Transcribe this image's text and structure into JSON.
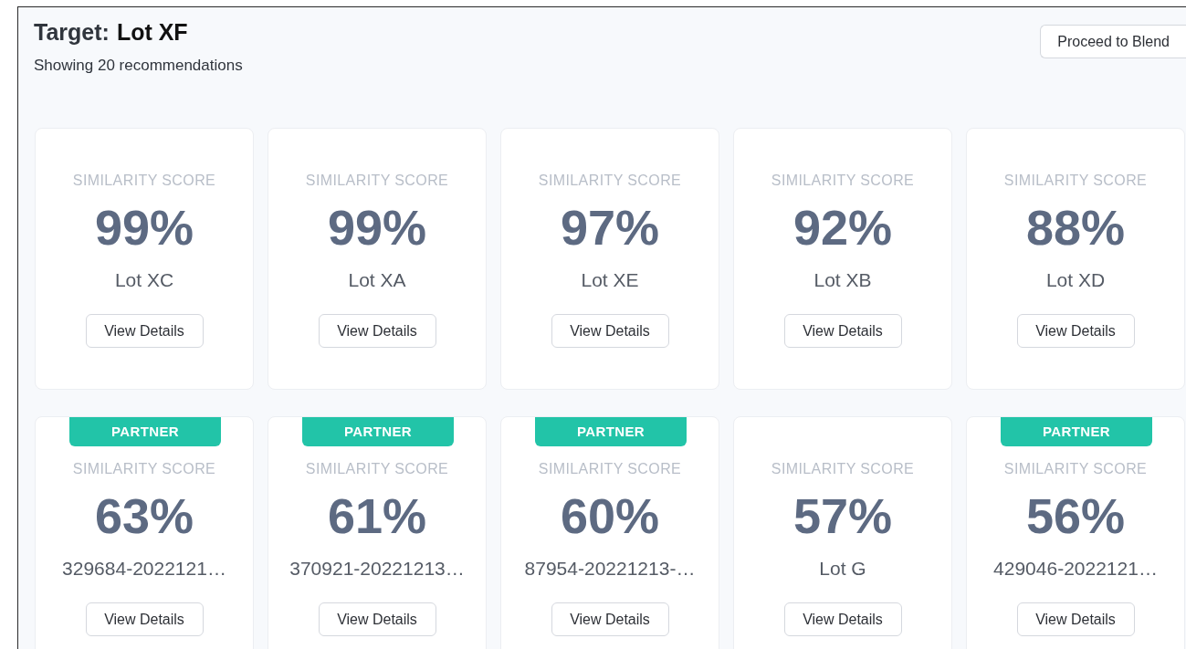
{
  "header": {
    "target_label": "Target:",
    "target_value": "Lot XF",
    "subtitle": "Showing 20 recommendations",
    "proceed_button": "Proceed to Blend"
  },
  "cards": [
    {
      "partner": false,
      "score_label": "SIMILARITY SCORE",
      "score": "99%",
      "name": "Lot XC",
      "button": "View Details"
    },
    {
      "partner": false,
      "score_label": "SIMILARITY SCORE",
      "score": "99%",
      "name": "Lot XA",
      "button": "View Details"
    },
    {
      "partner": false,
      "score_label": "SIMILARITY SCORE",
      "score": "97%",
      "name": "Lot XE",
      "button": "View Details"
    },
    {
      "partner": false,
      "score_label": "SIMILARITY SCORE",
      "score": "92%",
      "name": "Lot XB",
      "button": "View Details"
    },
    {
      "partner": false,
      "score_label": "SIMILARITY SCORE",
      "score": "88%",
      "name": "Lot XD",
      "button": "View Details"
    },
    {
      "partner": true,
      "badge": "PARTNER",
      "score_label": "SIMILARITY SCORE",
      "score": "63%",
      "name": "329684-2022121…",
      "button": "View Details"
    },
    {
      "partner": true,
      "badge": "PARTNER",
      "score_label": "SIMILARITY SCORE",
      "score": "61%",
      "name": "370921-20221213…",
      "button": "View Details"
    },
    {
      "partner": true,
      "badge": "PARTNER",
      "score_label": "SIMILARITY SCORE",
      "score": "60%",
      "name": "87954-20221213-…",
      "button": "View Details"
    },
    {
      "partner": false,
      "score_label": "SIMILARITY SCORE",
      "score": "57%",
      "name": "Lot G",
      "button": "View Details"
    },
    {
      "partner": true,
      "badge": "PARTNER",
      "score_label": "SIMILARITY SCORE",
      "score": "56%",
      "name": "429046-2022121…",
      "button": "View Details"
    }
  ]
}
